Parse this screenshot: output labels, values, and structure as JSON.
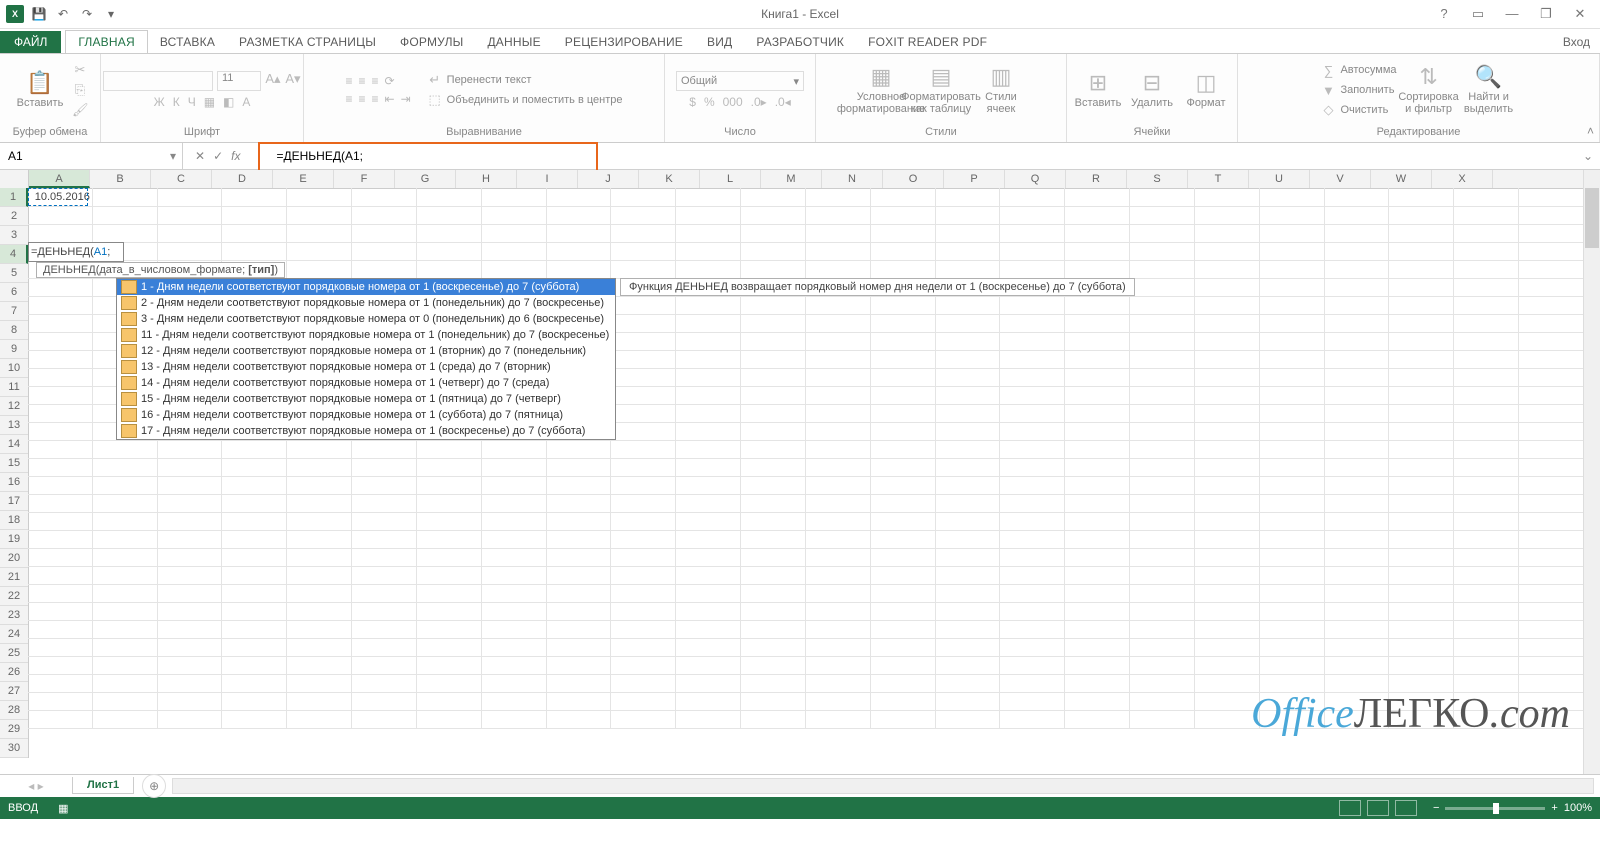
{
  "app": {
    "title": "Книга1 - Excel",
    "login": "Вход"
  },
  "qat": {
    "save": "save",
    "undo": "undo",
    "redo": "redo",
    "touch": "touch-mode"
  },
  "win": {
    "help": "?",
    "full": "▭",
    "min": "—",
    "restore": "❐",
    "close": "✕"
  },
  "tabs": {
    "file": "ФАЙЛ",
    "items": [
      "ГЛАВНАЯ",
      "ВСТАВКА",
      "РАЗМЕТКА СТРАНИЦЫ",
      "ФОРМУЛЫ",
      "ДАННЫЕ",
      "РЕЦЕНЗИРОВАНИЕ",
      "ВИД",
      "РАЗРАБОТЧИК",
      "FOXIT READER PDF"
    ],
    "active": 0
  },
  "ribbon": {
    "clipboard": {
      "paste": "Вставить",
      "label": "Буфер обмена"
    },
    "font": {
      "name": "—",
      "size": "11",
      "label": "Шрифт",
      "bold": "Ж",
      "italic": "К",
      "underline": "Ч"
    },
    "alignment": {
      "wrap": "Перенести текст",
      "merge": "Объединить и поместить в центре",
      "label": "Выравнивание"
    },
    "number": {
      "format": "Общий",
      "label": "Число"
    },
    "styles": {
      "cond": "Условное форматирование",
      "table": "Форматировать как таблицу",
      "cellstyles": "Стили ячеек",
      "label": "Стили"
    },
    "cells": {
      "insert": "Вставить",
      "delete": "Удалить",
      "format": "Формат",
      "label": "Ячейки"
    },
    "editing": {
      "autosum": "Автосумма",
      "fill": "Заполнить",
      "clear": "Очистить",
      "sort": "Сортировка и фильтр",
      "find": "Найти и выделить",
      "label": "Редактирование"
    }
  },
  "namebox": {
    "ref": "A1"
  },
  "formula": {
    "text": "=ДЕНЬНЕД(A1;"
  },
  "columns": [
    "A",
    "B",
    "C",
    "D",
    "E",
    "F",
    "G",
    "H",
    "I",
    "J",
    "K",
    "L",
    "M",
    "N",
    "O",
    "P",
    "Q",
    "R",
    "S",
    "T",
    "U",
    "V",
    "W",
    "X"
  ],
  "rows": [
    "1",
    "2",
    "3",
    "4",
    "5",
    "6",
    "7",
    "8",
    "9",
    "10",
    "11",
    "12",
    "13",
    "14",
    "15",
    "16",
    "17",
    "18",
    "19",
    "20",
    "21",
    "22",
    "23",
    "24",
    "25",
    "26",
    "27",
    "28",
    "29",
    "30"
  ],
  "cellsData": {
    "A1": "10.05.2016"
  },
  "edit": {
    "prefix": "=ДЕНЬНЕД(",
    "arg": "A1",
    "suffix": ";"
  },
  "hint": {
    "fn": "ДЕНЬНЕД",
    "args": "(дата_в_числовом_формате; ",
    "bold": "[тип]",
    "end": ")"
  },
  "dropdown": [
    "1 - Дням недели соответствуют порядковые номера от 1 (воскресенье) до 7 (суббота)",
    "2 - Дням недели соответствуют порядковые номера от 1 (понедельник) до 7 (воскресенье)",
    "3 - Дням недели соответствуют порядковые номера от 0 (понедельник) до 6 (воскресенье)",
    "11 - Дням недели соответствуют порядковые номера от 1 (понедельник) до 7 (воскресенье)",
    "12 - Дням недели соответствуют порядковые номера от 1 (вторник) до 7 (понедельник)",
    "13 - Дням недели соответствуют порядковые номера от 1 (среда) до 7 (вторник)",
    "14 - Дням недели соответствуют порядковые номера от 1 (четверг) до 7 (среда)",
    "15 - Дням недели соответствуют порядковые номера от 1 (пятница) до 7 (четверг)",
    "16 - Дням недели соответствуют порядковые номера от 1 (суббота) до 7 (пятница)",
    "17 - Дням недели соответствуют порядковые номера от 1 (воскресенье) до 7 (суббота)"
  ],
  "dropdownSelected": 0,
  "descTip": "Функция ДЕНЬНЕД возвращает порядковый номер дня недели от 1 (воскресенье) до 7 (суббота)",
  "sheets": {
    "active": "Лист1"
  },
  "status": {
    "mode": "ВВОД",
    "zoom": "100%"
  },
  "watermark": {
    "part1": "Office",
    "part2": "ЛЕГКО",
    "part3": ".com"
  }
}
